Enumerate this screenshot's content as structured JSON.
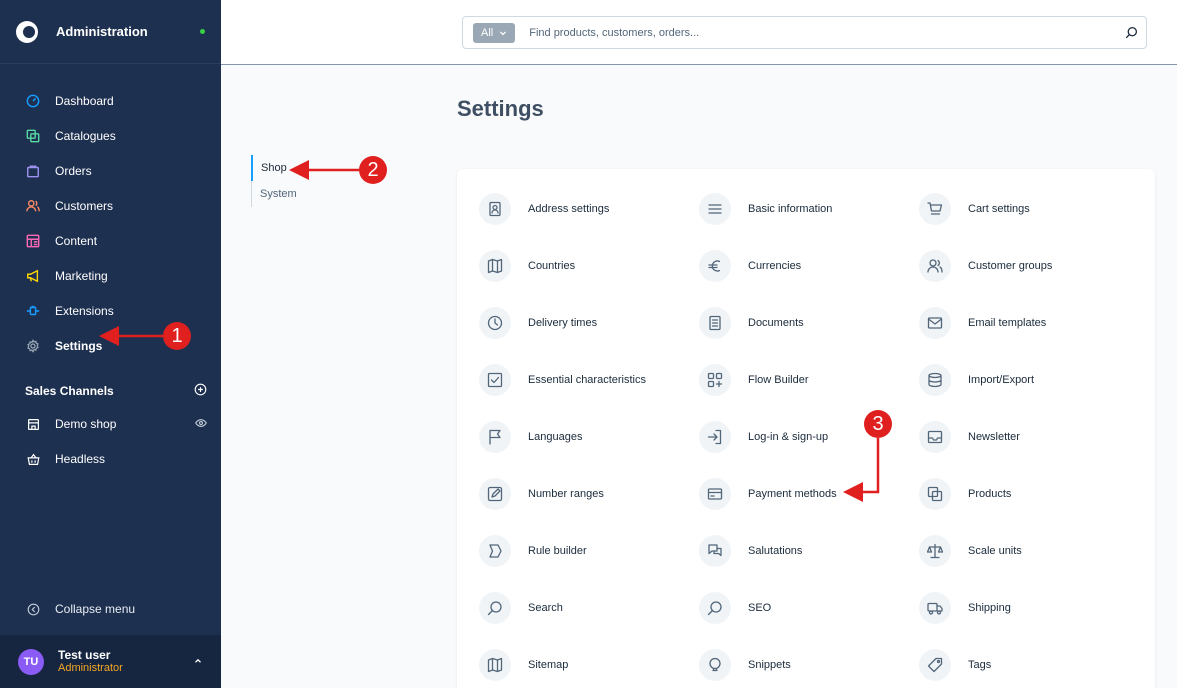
{
  "sidebar": {
    "title": "Administration",
    "nav": [
      {
        "label": "Dashboard",
        "icon": "gauge-icon",
        "color": "#189eff"
      },
      {
        "label": "Catalogues",
        "icon": "catalogue-icon",
        "color": "#57d9a3"
      },
      {
        "label": "Orders",
        "icon": "bag-icon",
        "color": "#a092f0"
      },
      {
        "label": "Customers",
        "icon": "users-icon",
        "color": "#f88962"
      },
      {
        "label": "Content",
        "icon": "content-icon",
        "color": "#ff68b4"
      },
      {
        "label": "Marketing",
        "icon": "megaphone-icon",
        "color": "#ffd700"
      },
      {
        "label": "Extensions",
        "icon": "plug-icon",
        "color": "#189eff"
      },
      {
        "label": "Settings",
        "icon": "gear-icon",
        "color": "#9aa8b5"
      }
    ],
    "sales_channels_label": "Sales Channels",
    "channels": [
      {
        "label": "Demo shop",
        "icon": "storefront-icon"
      },
      {
        "label": "Headless",
        "icon": "basket-icon"
      }
    ],
    "collapse_label": "Collapse menu",
    "user": {
      "initials": "TU",
      "name": "Test user",
      "role": "Administrator"
    }
  },
  "search": {
    "filter_label": "All",
    "placeholder": "Find products, customers, orders..."
  },
  "page": {
    "title": "Settings",
    "tabs": [
      "Shop",
      "System"
    ]
  },
  "settings_items": [
    {
      "label": "Address settings",
      "icon": "address-book-icon"
    },
    {
      "label": "Basic information",
      "icon": "hamburger-icon"
    },
    {
      "label": "Cart settings",
      "icon": "cart-icon"
    },
    {
      "label": "Countries",
      "icon": "map-icon"
    },
    {
      "label": "Currencies",
      "icon": "euro-icon"
    },
    {
      "label": "Customer groups",
      "icon": "users-icon"
    },
    {
      "label": "Delivery times",
      "icon": "clock-icon"
    },
    {
      "label": "Documents",
      "icon": "document-icon"
    },
    {
      "label": "Email templates",
      "icon": "envelope-icon"
    },
    {
      "label": "Essential characteristics",
      "icon": "checkbox-icon"
    },
    {
      "label": "Flow Builder",
      "icon": "flow-icon"
    },
    {
      "label": "Import/Export",
      "icon": "database-icon"
    },
    {
      "label": "Languages",
      "icon": "flag-icon"
    },
    {
      "label": "Log-in & sign-up",
      "icon": "login-icon"
    },
    {
      "label": "Newsletter",
      "icon": "inbox-icon"
    },
    {
      "label": "Number ranges",
      "icon": "pencil-square-icon"
    },
    {
      "label": "Payment methods",
      "icon": "credit-card-icon"
    },
    {
      "label": "Products",
      "icon": "products-icon"
    },
    {
      "label": "Rule builder",
      "icon": "rule-icon"
    },
    {
      "label": "Salutations",
      "icon": "chat-icon"
    },
    {
      "label": "Scale units",
      "icon": "scale-icon"
    },
    {
      "label": "Search",
      "icon": "search-icon"
    },
    {
      "label": "SEO",
      "icon": "search-icon"
    },
    {
      "label": "Shipping",
      "icon": "truck-icon"
    },
    {
      "label": "Sitemap",
      "icon": "map-icon"
    },
    {
      "label": "Snippets",
      "icon": "lightbulb-icon"
    },
    {
      "label": "Tags",
      "icon": "tag-icon"
    }
  ],
  "annotations": [
    "1",
    "2",
    "3"
  ],
  "colors": {
    "sidebar_bg": "#1e3050",
    "accent": "#189eff",
    "annotation": "#e01f1f"
  }
}
